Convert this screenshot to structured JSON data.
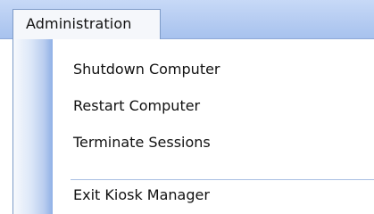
{
  "menubar": {
    "title": "Administration"
  },
  "menu": {
    "items": [
      {
        "label": "Shutdown Computer"
      },
      {
        "label": "Restart Computer"
      },
      {
        "label": "Terminate Sessions"
      },
      {
        "label": "Exit Kiosk Manager"
      }
    ]
  },
  "colors": {
    "menubar_top": "#c7d9f7",
    "menubar_bottom": "#a7c2ee",
    "border": "#7d9bc8",
    "icon_strip_dark": "#8fb0e6",
    "separator": "#a9bfe3"
  }
}
